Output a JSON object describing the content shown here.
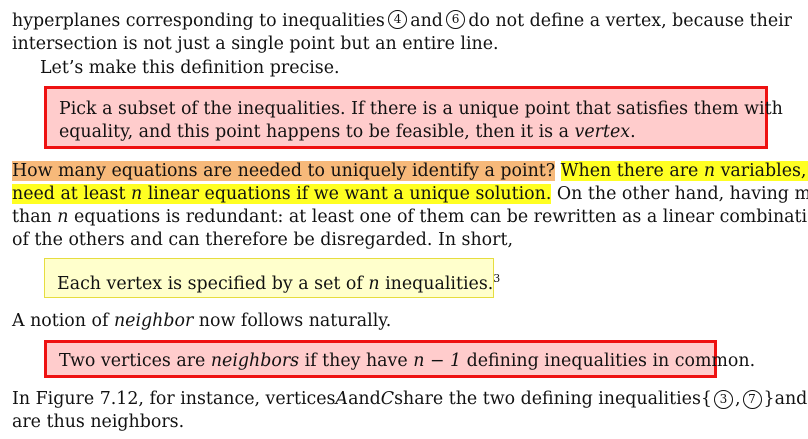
{
  "para1": {
    "line1_before": "hyperplanes corresponding to inequalities",
    "circ_a": "4",
    "word_and": "and",
    "circ_b": "6",
    "line1_after": "do not define a vertex, because their",
    "line2": "intersection is not just a single point but an entire line.",
    "line3": "Let’s make this definition precise."
  },
  "definition_box": {
    "line1": "Pick a subset of the inequalities. If there is a unique point that satisfies them with",
    "line2_before": "equality, and this point happens to be feasible, then it is a",
    "line2_em": "vertex",
    "line2_after": "."
  },
  "para2": {
    "highlight_orange": "How many equations are needed to uniquely identify a point?",
    "line1_yellow_a": "When there are",
    "var_n": "n",
    "line1_yellow_b": "variables, we",
    "line2_yellow_a": "need at least",
    "line2_yellow_b": "linear equations if we want a unique solution.",
    "line2_after": "On the other hand, having more",
    "line3_a": "than",
    "line3_b": "equations is redundant: at least one of them can be rewritten as a linear combination",
    "line4": "of the others and can therefore be disregarded. In short,"
  },
  "vertex_box": {
    "text_a": "Each vertex is specified by a set of",
    "text_b": "inequalities.",
    "footnote": "3"
  },
  "para3": {
    "before": "A notion of",
    "em": "neighbor",
    "after": "now follows naturally."
  },
  "neighbor_box": {
    "text_a": "Two vertices are",
    "em": "neighbors",
    "text_b": "if they have",
    "math": "n − 1",
    "text_c": "defining inequalities in common."
  },
  "para4": {
    "line1_a": "In Figure 7.12, for instance, vertices",
    "var_A": "A",
    "word_and": "and",
    "var_C": "C",
    "line1_b": "share the two defining inequalities",
    "set_open": "{",
    "circ_a": "3",
    "comma": ",",
    "circ_b": "7",
    "set_close": "}",
    "line1_c": "and",
    "line2": "are thus neighbors."
  },
  "colors": {
    "red_box_fill": "#ffcccc",
    "red_box_border": "#ee1111",
    "yellow_box_fill": "#ffffcc",
    "yellow_box_border": "#e6dd40",
    "highlight_orange": "#f7b97a",
    "highlight_yellow": "#ffff22"
  }
}
